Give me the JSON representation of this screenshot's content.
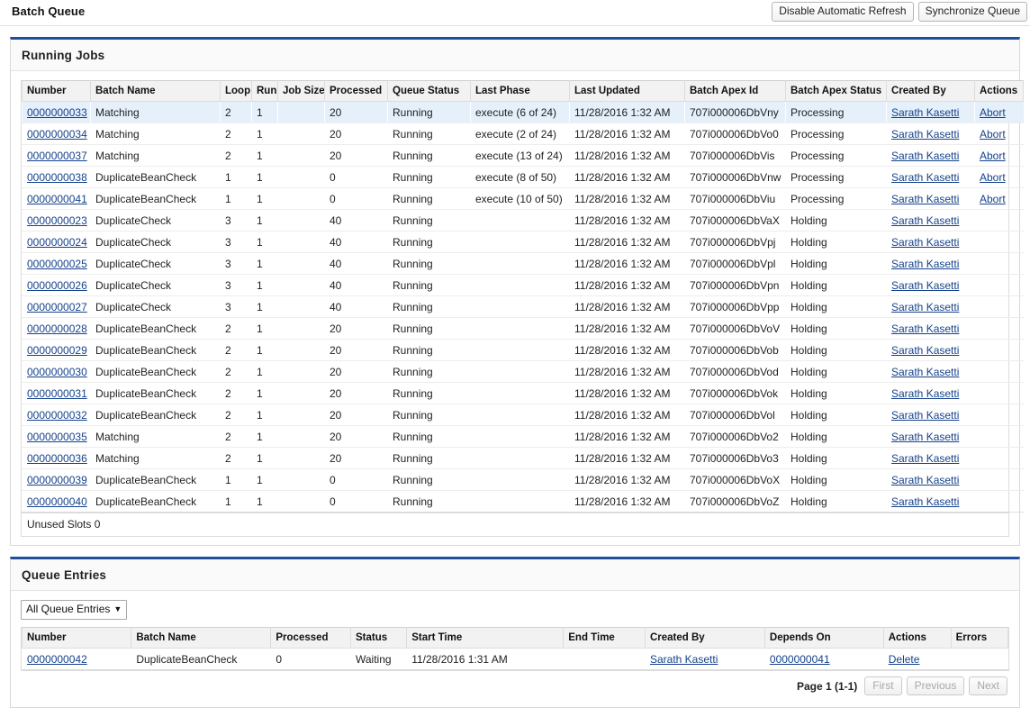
{
  "header": {
    "title": "Batch Queue",
    "buttons": [
      {
        "label": "Disable Automatic Refresh",
        "name": "disable-automatic-refresh-button"
      },
      {
        "label": "Synchronize Queue",
        "name": "synchronize-queue-button"
      }
    ]
  },
  "running_jobs": {
    "title": "Running Jobs",
    "columns": [
      "Number",
      "Batch Name",
      "Loop",
      "Run",
      "Job Size",
      "Processed",
      "Queue Status",
      "Last Phase",
      "Last Updated",
      "Batch Apex Id",
      "Batch Apex Status",
      "Created By",
      "Actions"
    ],
    "rows": [
      {
        "number": "0000000033",
        "batch_name": "Matching",
        "loop": "2",
        "run": "1",
        "job_size": "",
        "processed": "20",
        "queue_status": "Running",
        "last_phase": "execute (6 of 24)",
        "last_updated": "11/28/2016 1:32 AM",
        "batch_apex_id": "707i000006DbVny",
        "batch_apex_status": "Processing",
        "created_by": "Sarath Kasetti",
        "action": "Abort"
      },
      {
        "number": "0000000034",
        "batch_name": "Matching",
        "loop": "2",
        "run": "1",
        "job_size": "",
        "processed": "20",
        "queue_status": "Running",
        "last_phase": "execute (2 of 24)",
        "last_updated": "11/28/2016 1:32 AM",
        "batch_apex_id": "707i000006DbVo0",
        "batch_apex_status": "Processing",
        "created_by": "Sarath Kasetti",
        "action": "Abort"
      },
      {
        "number": "0000000037",
        "batch_name": "Matching",
        "loop": "2",
        "run": "1",
        "job_size": "",
        "processed": "20",
        "queue_status": "Running",
        "last_phase": "execute (13 of 24)",
        "last_updated": "11/28/2016 1:32 AM",
        "batch_apex_id": "707i000006DbVis",
        "batch_apex_status": "Processing",
        "created_by": "Sarath Kasetti",
        "action": "Abort"
      },
      {
        "number": "0000000038",
        "batch_name": "DuplicateBeanCheck",
        "loop": "1",
        "run": "1",
        "job_size": "",
        "processed": "0",
        "queue_status": "Running",
        "last_phase": "execute (8 of 50)",
        "last_updated": "11/28/2016 1:32 AM",
        "batch_apex_id": "707i000006DbVnw",
        "batch_apex_status": "Processing",
        "created_by": "Sarath Kasetti",
        "action": "Abort"
      },
      {
        "number": "0000000041",
        "batch_name": "DuplicateBeanCheck",
        "loop": "1",
        "run": "1",
        "job_size": "",
        "processed": "0",
        "queue_status": "Running",
        "last_phase": "execute (10 of 50)",
        "last_updated": "11/28/2016 1:32 AM",
        "batch_apex_id": "707i000006DbViu",
        "batch_apex_status": "Processing",
        "created_by": "Sarath Kasetti",
        "action": "Abort"
      },
      {
        "number": "0000000023",
        "batch_name": "DuplicateCheck",
        "loop": "3",
        "run": "1",
        "job_size": "",
        "processed": "40",
        "queue_status": "Running",
        "last_phase": "",
        "last_updated": "11/28/2016 1:32 AM",
        "batch_apex_id": "707i000006DbVaX",
        "batch_apex_status": "Holding",
        "created_by": "Sarath Kasetti",
        "action": ""
      },
      {
        "number": "0000000024",
        "batch_name": "DuplicateCheck",
        "loop": "3",
        "run": "1",
        "job_size": "",
        "processed": "40",
        "queue_status": "Running",
        "last_phase": "",
        "last_updated": "11/28/2016 1:32 AM",
        "batch_apex_id": "707i000006DbVpj",
        "batch_apex_status": "Holding",
        "created_by": "Sarath Kasetti",
        "action": ""
      },
      {
        "number": "0000000025",
        "batch_name": "DuplicateCheck",
        "loop": "3",
        "run": "1",
        "job_size": "",
        "processed": "40",
        "queue_status": "Running",
        "last_phase": "",
        "last_updated": "11/28/2016 1:32 AM",
        "batch_apex_id": "707i000006DbVpl",
        "batch_apex_status": "Holding",
        "created_by": "Sarath Kasetti",
        "action": ""
      },
      {
        "number": "0000000026",
        "batch_name": "DuplicateCheck",
        "loop": "3",
        "run": "1",
        "job_size": "",
        "processed": "40",
        "queue_status": "Running",
        "last_phase": "",
        "last_updated": "11/28/2016 1:32 AM",
        "batch_apex_id": "707i000006DbVpn",
        "batch_apex_status": "Holding",
        "created_by": "Sarath Kasetti",
        "action": ""
      },
      {
        "number": "0000000027",
        "batch_name": "DuplicateCheck",
        "loop": "3",
        "run": "1",
        "job_size": "",
        "processed": "40",
        "queue_status": "Running",
        "last_phase": "",
        "last_updated": "11/28/2016 1:32 AM",
        "batch_apex_id": "707i000006DbVpp",
        "batch_apex_status": "Holding",
        "created_by": "Sarath Kasetti",
        "action": ""
      },
      {
        "number": "0000000028",
        "batch_name": "DuplicateBeanCheck",
        "loop": "2",
        "run": "1",
        "job_size": "",
        "processed": "20",
        "queue_status": "Running",
        "last_phase": "",
        "last_updated": "11/28/2016 1:32 AM",
        "batch_apex_id": "707i000006DbVoV",
        "batch_apex_status": "Holding",
        "created_by": "Sarath Kasetti",
        "action": ""
      },
      {
        "number": "0000000029",
        "batch_name": "DuplicateBeanCheck",
        "loop": "2",
        "run": "1",
        "job_size": "",
        "processed": "20",
        "queue_status": "Running",
        "last_phase": "",
        "last_updated": "11/28/2016 1:32 AM",
        "batch_apex_id": "707i000006DbVob",
        "batch_apex_status": "Holding",
        "created_by": "Sarath Kasetti",
        "action": ""
      },
      {
        "number": "0000000030",
        "batch_name": "DuplicateBeanCheck",
        "loop": "2",
        "run": "1",
        "job_size": "",
        "processed": "20",
        "queue_status": "Running",
        "last_phase": "",
        "last_updated": "11/28/2016 1:32 AM",
        "batch_apex_id": "707i000006DbVod",
        "batch_apex_status": "Holding",
        "created_by": "Sarath Kasetti",
        "action": ""
      },
      {
        "number": "0000000031",
        "batch_name": "DuplicateBeanCheck",
        "loop": "2",
        "run": "1",
        "job_size": "",
        "processed": "20",
        "queue_status": "Running",
        "last_phase": "",
        "last_updated": "11/28/2016 1:32 AM",
        "batch_apex_id": "707i000006DbVok",
        "batch_apex_status": "Holding",
        "created_by": "Sarath Kasetti",
        "action": ""
      },
      {
        "number": "0000000032",
        "batch_name": "DuplicateBeanCheck",
        "loop": "2",
        "run": "1",
        "job_size": "",
        "processed": "20",
        "queue_status": "Running",
        "last_phase": "",
        "last_updated": "11/28/2016 1:32 AM",
        "batch_apex_id": "707i000006DbVol",
        "batch_apex_status": "Holding",
        "created_by": "Sarath Kasetti",
        "action": ""
      },
      {
        "number": "0000000035",
        "batch_name": "Matching",
        "loop": "2",
        "run": "1",
        "job_size": "",
        "processed": "20",
        "queue_status": "Running",
        "last_phase": "",
        "last_updated": "11/28/2016 1:32 AM",
        "batch_apex_id": "707i000006DbVo2",
        "batch_apex_status": "Holding",
        "created_by": "Sarath Kasetti",
        "action": ""
      },
      {
        "number": "0000000036",
        "batch_name": "Matching",
        "loop": "2",
        "run": "1",
        "job_size": "",
        "processed": "20",
        "queue_status": "Running",
        "last_phase": "",
        "last_updated": "11/28/2016 1:32 AM",
        "batch_apex_id": "707i000006DbVo3",
        "batch_apex_status": "Holding",
        "created_by": "Sarath Kasetti",
        "action": ""
      },
      {
        "number": "0000000039",
        "batch_name": "DuplicateBeanCheck",
        "loop": "1",
        "run": "1",
        "job_size": "",
        "processed": "0",
        "queue_status": "Running",
        "last_phase": "",
        "last_updated": "11/28/2016 1:32 AM",
        "batch_apex_id": "707i000006DbVoX",
        "batch_apex_status": "Holding",
        "created_by": "Sarath Kasetti",
        "action": ""
      },
      {
        "number": "0000000040",
        "batch_name": "DuplicateBeanCheck",
        "loop": "1",
        "run": "1",
        "job_size": "",
        "processed": "0",
        "queue_status": "Running",
        "last_phase": "",
        "last_updated": "11/28/2016 1:32 AM",
        "batch_apex_id": "707i000006DbVoZ",
        "batch_apex_status": "Holding",
        "created_by": "Sarath Kasetti",
        "action": ""
      }
    ],
    "footer": "Unused Slots 0"
  },
  "queue_entries": {
    "title": "Queue Entries",
    "filter": {
      "selected": "All Queue Entries",
      "caret": "▼"
    },
    "columns": [
      "Number",
      "Batch Name",
      "Processed",
      "Status",
      "Start Time",
      "End Time",
      "Created By",
      "Depends On",
      "Actions",
      "Errors"
    ],
    "rows": [
      {
        "number": "0000000042",
        "batch_name": "DuplicateBeanCheck",
        "processed": "0",
        "status": "Waiting",
        "start_time": "11/28/2016 1:31 AM",
        "end_time": "",
        "created_by": "Sarath Kasetti",
        "depends_on": "0000000041",
        "action": "Delete",
        "errors": ""
      }
    ],
    "pager": {
      "page_label": "Page 1 (1-1)",
      "first": "First",
      "previous": "Previous",
      "next": "Next"
    }
  },
  "colors": {
    "panel_accent": "#1f4f9c",
    "link": "#15428b",
    "row_highlight": "#e5f0fb",
    "header_bg": "#f2f2f2"
  }
}
